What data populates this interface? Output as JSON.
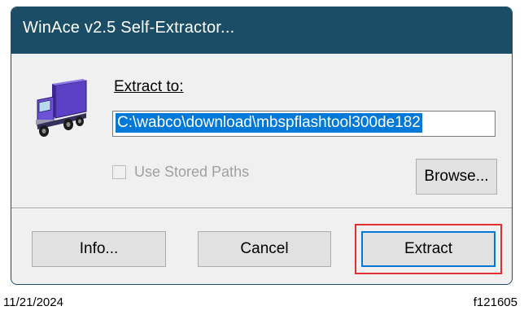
{
  "window": {
    "title": "WinAce v2.5 Self-Extractor..."
  },
  "extract": {
    "label": "Extract to:",
    "path": "C:\\wabco\\download\\mbspflashtool300de182"
  },
  "options": {
    "use_stored_paths_label": "Use Stored Paths",
    "use_stored_paths_checked": false,
    "use_stored_paths_enabled": false
  },
  "buttons": {
    "browse": "Browse...",
    "info": "Info...",
    "cancel": "Cancel",
    "extract": "Extract"
  },
  "footer": {
    "date": "11/21/2024",
    "figure_id": "f121605"
  },
  "icons": {
    "app": "truck-icon"
  },
  "colors": {
    "titlebar": "#1b4d66",
    "selection": "#0078d7",
    "highlight": "#e03030"
  }
}
